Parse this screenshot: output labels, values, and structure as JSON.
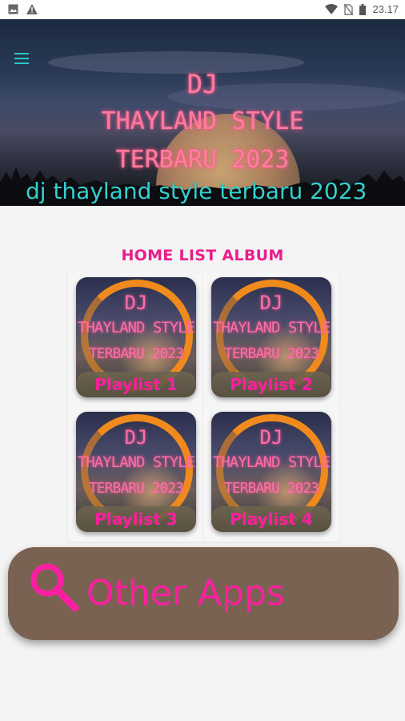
{
  "status_bar": {
    "time": "23.17",
    "left_icons": [
      "image-icon",
      "warning-icon"
    ],
    "right_icons": [
      "wifi-icon",
      "no-sim-icon",
      "battery-icon"
    ]
  },
  "header": {
    "menu_icon": "hamburger-icon",
    "banner_lines": [
      "DJ",
      "THAYLAND STYLE",
      "TERBARU 2023"
    ],
    "subtitle": "dj thayland style terbaru 2023"
  },
  "home": {
    "title": "HOME LIST ALBUM",
    "cover_lines": [
      "DJ",
      "THAYLAND STYLE",
      "TERBARU 2023"
    ],
    "playlists": [
      {
        "label": "Playlist 1"
      },
      {
        "label": "Playlist 2"
      },
      {
        "label": "Playlist 3"
      },
      {
        "label": "Playlist 4"
      }
    ]
  },
  "other_apps": {
    "label": "Other Apps",
    "icon": "search-icon"
  },
  "colors": {
    "accent_pink": "#e91e8c",
    "label_pink": "#ff1fa0",
    "subtitle_teal": "#36d1cf",
    "button_brown": "#7a6252"
  }
}
